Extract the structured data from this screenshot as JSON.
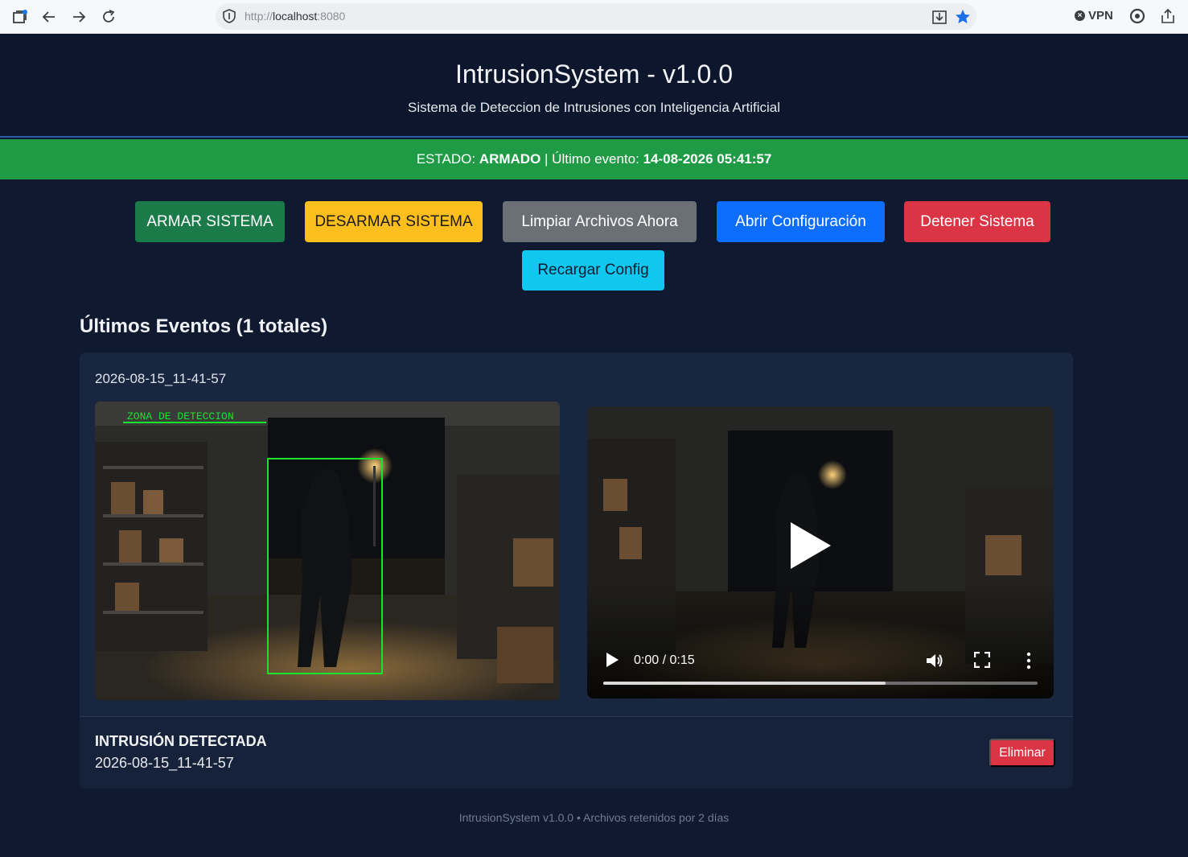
{
  "browser": {
    "url_scheme": "http://",
    "url_host": "localhost",
    "url_port": ":8080",
    "vpn_label": "VPN",
    "vpn_icon_glyph": "×",
    "icons": [
      "tabs-icon",
      "back-arrow-icon",
      "forward-arrow-icon",
      "reload-icon",
      "shield-icon",
      "save-to-device-icon",
      "bookmark-star-icon",
      "extensions-icon",
      "share-icon"
    ]
  },
  "header": {
    "title": "IntrusionSystem - v1.0.0",
    "subtitle": "Sistema de Deteccion de Intrusiones con Inteligencia Artificial"
  },
  "status": {
    "label": "ESTADO:",
    "state": "ARMADO",
    "separator": " | ",
    "last_event_label": "Último evento:",
    "last_event_value": "14-08-2026 05:41:57",
    "color": "#1f9a45"
  },
  "actions": {
    "arm": "ARMAR SISTEMA",
    "disarm": "DESARMAR SISTEMA",
    "clean": "Limpiar Archivos Ahora",
    "config": "Abrir Configuración",
    "stop": "Detener Sistema",
    "reload": "Recargar Config"
  },
  "events": {
    "heading": "Últimos Eventos (1 totales)",
    "items": [
      {
        "stamp": "2026-08-15_11-41-57",
        "image_overlay_label": "ZONA DE DETECCION",
        "type": "INTRUSIÓN DETECTADA",
        "footer_stamp": "2026-08-15_11-41-57",
        "delete_label": "Eliminar",
        "video": {
          "time": "0:00 / 0:15",
          "buffered_fraction": 0.65
        }
      }
    ]
  },
  "footer": {
    "text": "IntrusionSystem v1.0.0 • Archivos retenidos por 2 días"
  }
}
